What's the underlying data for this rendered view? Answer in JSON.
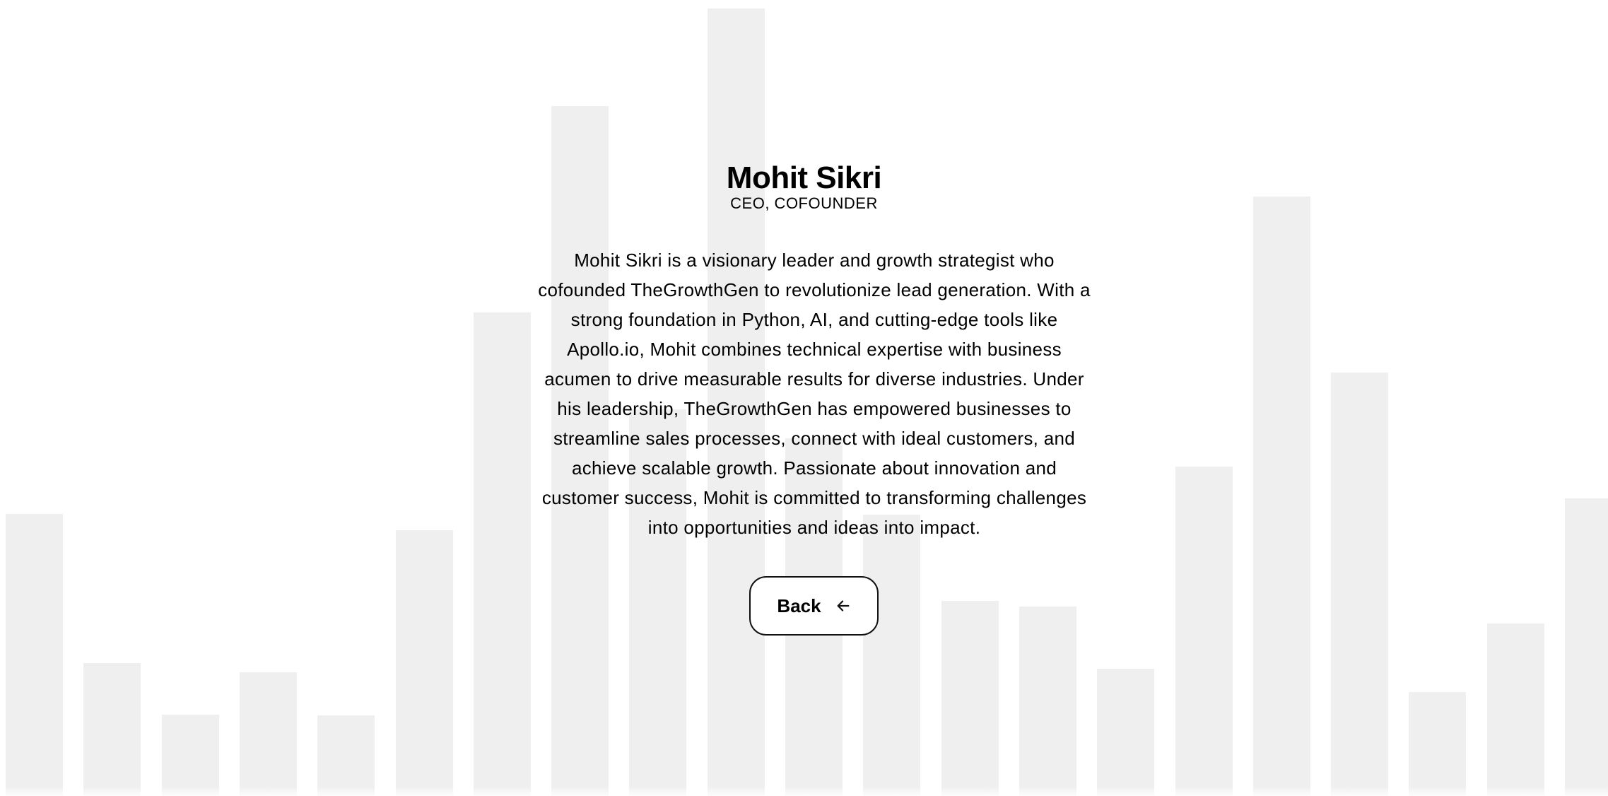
{
  "background": {
    "bar_color": "#efefef",
    "bar_heights": [
      0.356,
      0.168,
      0.103,
      0.156,
      0.102,
      0.336,
      0.611,
      0.871,
      0.488,
      0.995,
      0.452,
      0.355,
      0.246,
      0.239,
      0.161,
      0.416,
      0.757,
      0.535,
      0.131,
      0.218,
      0.376
    ]
  },
  "profile": {
    "name": "Mohit Sikri",
    "role": "CEO, COFOUNDER",
    "bio": "Mohit Sikri is a visionary leader and growth strategist who cofounded TheGrowthGen to revolutionize lead generation. With a strong foundation in Python, AI, and cutting-edge tools like Apollo.io, Mohit combines technical expertise with business acumen to drive measurable results for diverse industries. Under his leadership, TheGrowthGen has empowered businesses to streamline sales processes, connect with ideal customers, and achieve scalable growth. Passionate about innovation and customer success, Mohit is committed to transforming challenges into opportunities and ideas into impact."
  },
  "back_button": {
    "label": "Back",
    "icon": "arrow-left-icon"
  }
}
